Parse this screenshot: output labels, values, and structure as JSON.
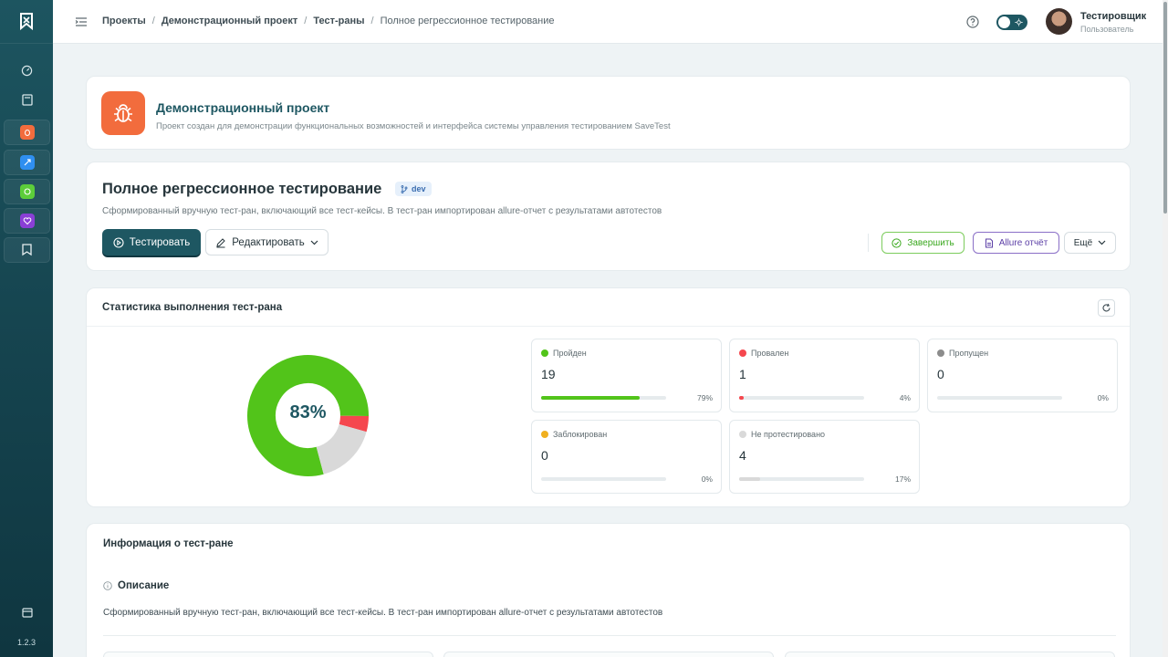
{
  "app": {
    "version": "1.2.3"
  },
  "colors": {
    "primary": "#1e5762",
    "passed": "#52c41a",
    "failed": "#f5474e",
    "skipped": "#8c8c8c",
    "blocked": "#f0b020",
    "untested": "#d9d9d9",
    "project_icon": "#f26c3d"
  },
  "sidebar": {
    "items": [
      {
        "icon": "dashboard-icon"
      },
      {
        "icon": "book-icon"
      },
      {
        "icon": "bug-project-icon",
        "color": "#f26c3d"
      },
      {
        "icon": "rocket-project-icon",
        "color": "#2f8ff0"
      },
      {
        "icon": "chat-project-icon",
        "color": "#5ccd3a"
      },
      {
        "icon": "heart-project-icon",
        "color": "#8a3fd6"
      },
      {
        "icon": "logo-project-icon",
        "color": "#e8eef0"
      },
      {
        "icon": "calendar-icon"
      }
    ]
  },
  "breadcrumb": {
    "items": [
      "Проекты",
      "Демонстрационный проект",
      "Тест-раны",
      "Полное регрессионное тестирование"
    ]
  },
  "user": {
    "name": "Тестировщик",
    "role": "Пользователь"
  },
  "project": {
    "title": "Демонстрационный проект",
    "description": "Проект создан для демонстрации функциональных возможностей и интерфейса системы управления тестированием SaveTest"
  },
  "run": {
    "title": "Полное регрессионное тестирование",
    "branch": "dev",
    "description": "Сформированный вручную тест-ран, включающий все тест-кейсы. В тест-ран импортирован allure-отчет с результатами автотестов",
    "buttons": {
      "test": "Тестировать",
      "edit": "Редактировать",
      "finish": "Завершить",
      "allure": "Allure отчёт",
      "more": "Ещё"
    }
  },
  "stats": {
    "title": "Статистика выполнения тест-рана",
    "donut_percent_label": "83%",
    "donut_segments": [
      {
        "status": "passed",
        "value": 19
      },
      {
        "status": "failed",
        "value": 1
      },
      {
        "status": "skipped",
        "value": 0
      },
      {
        "status": "blocked",
        "value": 0
      },
      {
        "status": "untested",
        "value": 4
      }
    ],
    "tiles": [
      {
        "label": "Пройден",
        "count": "19",
        "percent": "79%",
        "fraction": 0.79,
        "color": "#52c41a"
      },
      {
        "label": "Провален",
        "count": "1",
        "percent": "4%",
        "fraction": 0.04,
        "color": "#f5474e"
      },
      {
        "label": "Пропущен",
        "count": "0",
        "percent": "0%",
        "fraction": 0.0,
        "color": "#8c8c8c"
      },
      {
        "label": "Заблокирован",
        "count": "0",
        "percent": "0%",
        "fraction": 0.0,
        "color": "#f0b020"
      },
      {
        "label": "Не протестировано",
        "count": "4",
        "percent": "17%",
        "fraction": 0.17,
        "color": "#d9d9d9"
      }
    ]
  },
  "info": {
    "title": "Информация о тест-ране",
    "description_heading": "Описание",
    "description_text": "Сформированный вручную тест-ран, включающий все тест-кейсы. В тест-ран импортирован allure-отчет с результатами автотестов"
  }
}
